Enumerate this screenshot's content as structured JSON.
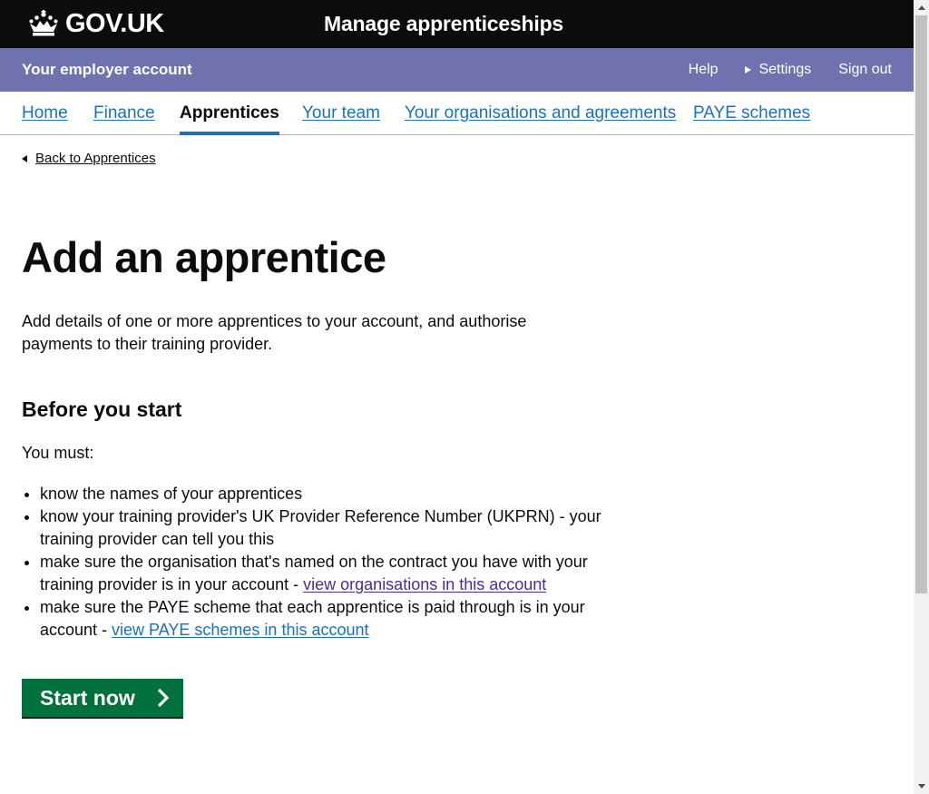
{
  "header": {
    "logo_text": "GOV.UK",
    "service_name": "Manage apprenticeships",
    "crown_icon": "crown-icon"
  },
  "account_bar": {
    "title": "Your employer account",
    "links": [
      {
        "label": "Help"
      },
      {
        "label": "Settings",
        "icon": "triangle-right-icon"
      },
      {
        "label": "Sign out"
      }
    ]
  },
  "nav": {
    "items": [
      {
        "label": "Home",
        "active": false
      },
      {
        "label": "Finance",
        "active": false
      },
      {
        "label": "Apprentices",
        "active": true
      },
      {
        "label": "Your team",
        "active": false
      },
      {
        "label": "Your organisations and agreements",
        "active": false
      },
      {
        "label": "PAYE schemes",
        "active": false
      }
    ]
  },
  "back_link": {
    "label": "Back to Apprentices",
    "icon": "triangle-left-icon"
  },
  "main": {
    "title": "Add an apprentice",
    "lead": "Add details of one or more apprentices to your account, and authorise payments to their training provider.",
    "section_title": "Before you start",
    "must_label": "You must:",
    "bullets": [
      {
        "text": "know the names of your apprentices"
      },
      {
        "text": "know your training provider's UK Provider Reference Number (UKPRN) - your training provider can tell you this"
      },
      {
        "text": "make sure the organisation that's named on the contract you have with your training provider is in your account - ",
        "link": "view organisations in this account"
      },
      {
        "text": "make sure the PAYE scheme that each apprentice is paid through is in your account - ",
        "link": "view PAYE schemes in this account"
      }
    ],
    "start_button": {
      "label": "Start now",
      "icon": "chevron-right-icon"
    }
  },
  "colors": {
    "header_bg": "#0b0c0c",
    "account_bar_bg": "#6f72af",
    "link": "#1d70b8",
    "visited_link": "#4c2c92",
    "nav_active_underline": "#1d70b8",
    "start_button_bg": "#00703c"
  }
}
